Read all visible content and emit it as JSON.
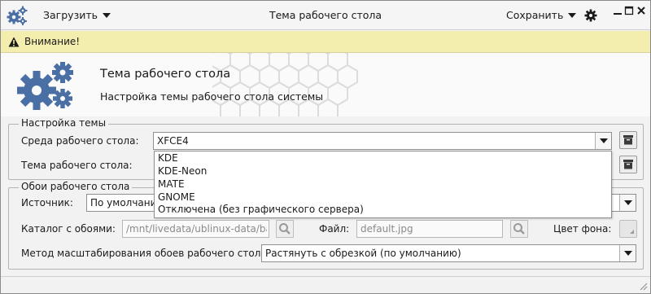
{
  "titlebar": {
    "load_label": "Загрузить",
    "title": "Тема рабочего стола",
    "save_label": "Сохранить"
  },
  "warning": {
    "text": "Внимание!"
  },
  "header": {
    "title": "Тема рабочего стола",
    "subtitle": "Настройка темы рабочего стола системы"
  },
  "theme_group": {
    "legend": "Настройка темы",
    "env_label": "Среда рабочего стола:",
    "env_value": "XFCE4",
    "theme_label": "Тема рабочего стола:",
    "env_options": [
      "KDE",
      "KDE-Neon",
      "MATE",
      "GNOME",
      "Отключена (без графического сервера)"
    ]
  },
  "wallpaper_group": {
    "legend": "Обои рабочего стола",
    "source_label": "Источник:",
    "source_value": "По умолчанию",
    "catalog_label": "Каталог с обоями:",
    "catalog_value": "/mnt/livedata/ublinux-data/ba",
    "file_label": "Файл:",
    "file_value": "default.jpg",
    "bg_color_label": "Цвет фона:",
    "scale_label": "Метод масштабирования обоев рабочего стола:",
    "scale_value": "Растянуть с обрезкой (по умолчанию)"
  },
  "colors": {
    "warning_bg": "#f3eead",
    "icon_blue": "#4a6fa5"
  }
}
